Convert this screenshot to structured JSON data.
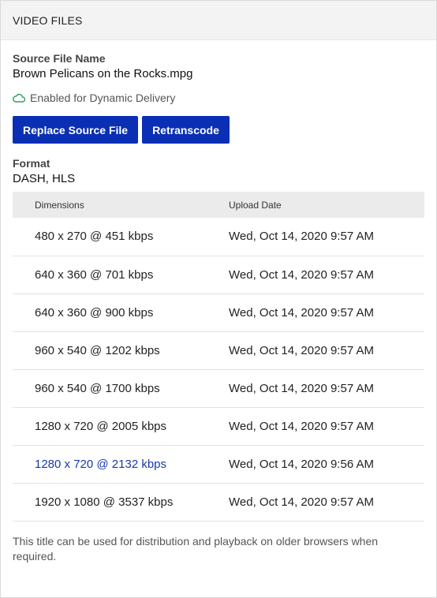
{
  "panel": {
    "title": "VIDEO FILES"
  },
  "source": {
    "label": "Source File Name",
    "value": "Brown Pelicans on the Rocks.mpg",
    "delivery_text": "Enabled for Dynamic Delivery",
    "delivery_icon": "cloud-icon",
    "delivery_color": "#2e9e5b"
  },
  "actions": {
    "replace_label": "Replace Source File",
    "retranscode_label": "Retranscode",
    "button_color": "#0a2fb5"
  },
  "format": {
    "label": "Format",
    "value": "DASH, HLS"
  },
  "table": {
    "headers": {
      "dimensions": "Dimensions",
      "upload_date": "Upload Date"
    },
    "rows": [
      {
        "dimensions": "480 x 270 @ 451 kbps",
        "upload_date": "Wed, Oct 14, 2020 9:57 AM",
        "is_link": false
      },
      {
        "dimensions": "640 x 360 @ 701 kbps",
        "upload_date": "Wed, Oct 14, 2020 9:57 AM",
        "is_link": false
      },
      {
        "dimensions": "640 x 360 @ 900 kbps",
        "upload_date": "Wed, Oct 14, 2020 9:57 AM",
        "is_link": false
      },
      {
        "dimensions": "960 x 540 @ 1202 kbps",
        "upload_date": "Wed, Oct 14, 2020 9:57 AM",
        "is_link": false
      },
      {
        "dimensions": "960 x 540 @ 1700 kbps",
        "upload_date": "Wed, Oct 14, 2020 9:57 AM",
        "is_link": false
      },
      {
        "dimensions": "1280 x 720 @ 2005 kbps",
        "upload_date": "Wed, Oct 14, 2020 9:57 AM",
        "is_link": false
      },
      {
        "dimensions": "1280 x 720 @ 2132 kbps",
        "upload_date": "Wed, Oct 14, 2020 9:56 AM",
        "is_link": true
      },
      {
        "dimensions": "1920 x 1080 @ 3537 kbps",
        "upload_date": "Wed, Oct 14, 2020 9:57 AM",
        "is_link": false
      }
    ]
  },
  "footnote": "This title can be used for distribution and playback on older browsers when required."
}
